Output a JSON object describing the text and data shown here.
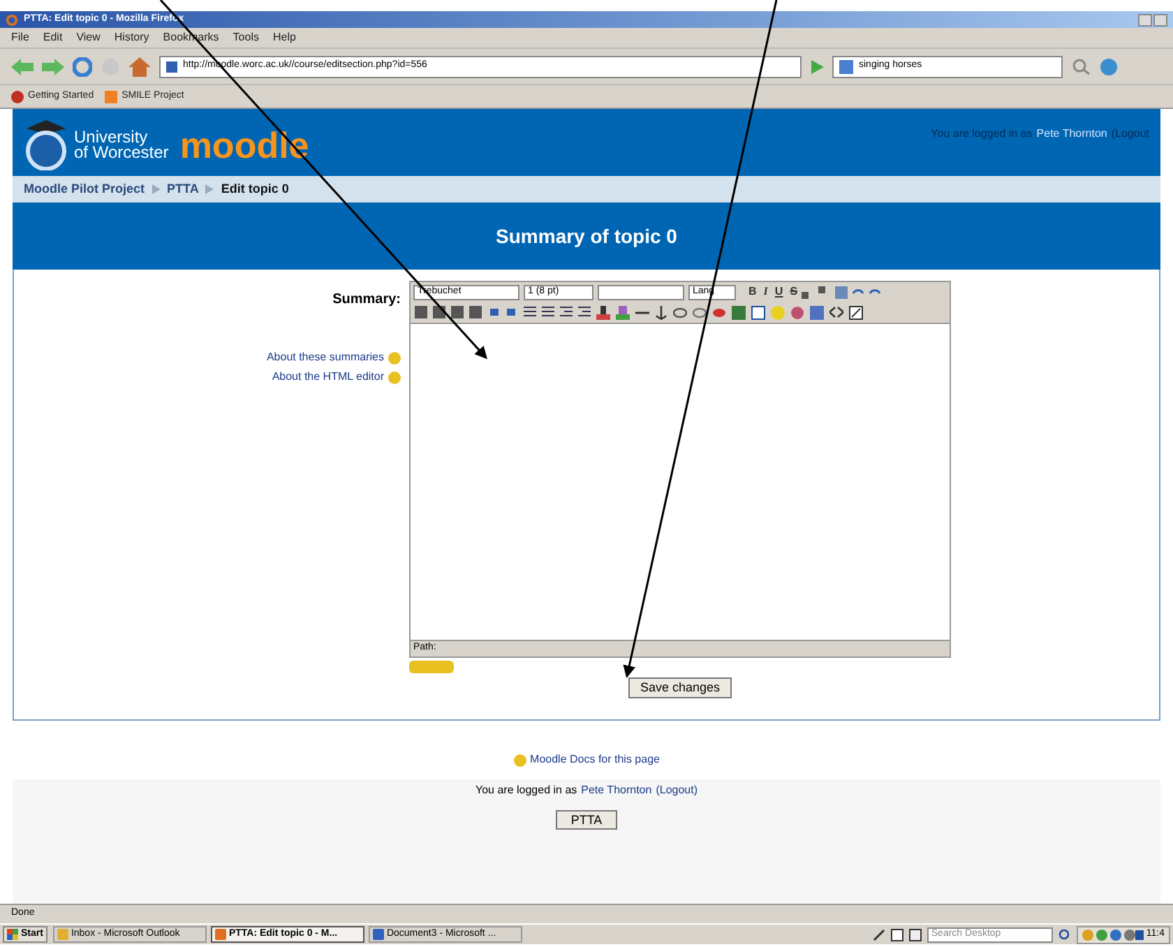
{
  "window": {
    "title": "PTTA: Edit topic 0 - Mozilla Firefox"
  },
  "menu": [
    "File",
    "Edit",
    "View",
    "History",
    "Bookmarks",
    "Tools",
    "Help"
  ],
  "address_bar": {
    "value": "http://moodle.worc.ac.uk//course/editsection.php?id=556"
  },
  "search": {
    "value": "singing horses"
  },
  "bookmarks": [
    "Getting Started",
    "SMILE Project"
  ],
  "header": {
    "logo_text": [
      "University",
      "of Worcester",
      "moodle"
    ],
    "login_prefix": "You are logged in as",
    "user": "Pete Thornton",
    "logout": "(Logout"
  },
  "breadcrumb": [
    "Moodle Pilot Project",
    "PTTA",
    "Edit topic 0"
  ],
  "heading": "Summary of topic 0",
  "form": {
    "label": "Summary:",
    "help_links": [
      "About these summaries",
      "About the HTML editor"
    ],
    "font": "Trebuchet",
    "size": "1 (8 pt)",
    "lang": "Lang",
    "format_buttons": [
      "B",
      "I",
      "U",
      "S"
    ],
    "path_label": "Path:",
    "save": "Save changes"
  },
  "docs_link": "Moodle Docs for this page",
  "footer": {
    "login_prefix": "You are logged in as",
    "user": "Pete Thornton",
    "logout": "(Logout)",
    "course_button": "PTTA"
  },
  "status": "Done",
  "taskbar": {
    "start": "Start",
    "tasks": [
      {
        "label": "Inbox - Microsoft Outlook",
        "selected": false
      },
      {
        "label": "PTTA: Edit topic 0 - M...",
        "selected": true
      },
      {
        "label": "Document3 - Microsoft ...",
        "selected": false
      }
    ],
    "search_placeholder": "Search Desktop",
    "clock": "11:4"
  }
}
